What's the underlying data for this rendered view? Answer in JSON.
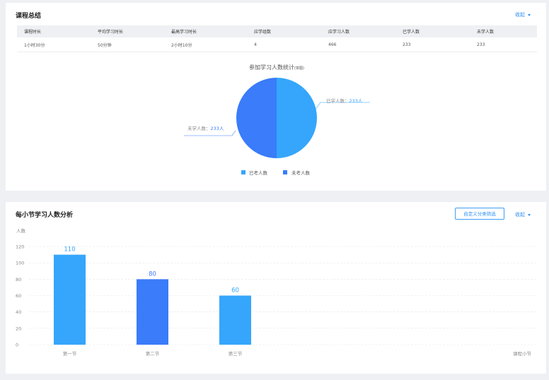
{
  "summary": {
    "title": "课程总结",
    "collapse_label": "收起",
    "columns": [
      "课程时长",
      "平均学习时长",
      "最高学习时长",
      "应学组数",
      "应学习人数",
      "已学人数",
      "未学人数"
    ],
    "row": [
      "1小时30分",
      "50分钟",
      "2小时10分",
      "4",
      "466",
      "233",
      "233"
    ]
  },
  "pie": {
    "title": "参加学习人数统计",
    "title_suffix": "(饼图)",
    "slices": [
      {
        "name": "已学人数",
        "value": 233,
        "label": "已学人数：",
        "value_label": "233人",
        "color": "#35a6fb"
      },
      {
        "name": "未学人数",
        "value": 233,
        "label": "未学人数：",
        "value_label": "233人",
        "color": "#3a7cf9"
      }
    ],
    "legend": [
      "已考人数",
      "未考人数"
    ]
  },
  "sections": {
    "title": "每小节学习人数分析",
    "filter_button": "自定义分类筛选",
    "collapse_label": "收起"
  },
  "chart_data": {
    "type": "bar",
    "categories": [
      "第一节",
      "第二节",
      "第三节"
    ],
    "values": [
      110,
      80,
      60
    ],
    "ylabel": "人数",
    "xlabel": "课程小节",
    "ylim": [
      0,
      120
    ],
    "yticks": [
      0,
      20,
      40,
      60,
      80,
      100,
      120
    ],
    "bar_colors": [
      "#35a6fb",
      "#3a7cf9",
      "#35a6fb"
    ],
    "grid": true
  }
}
